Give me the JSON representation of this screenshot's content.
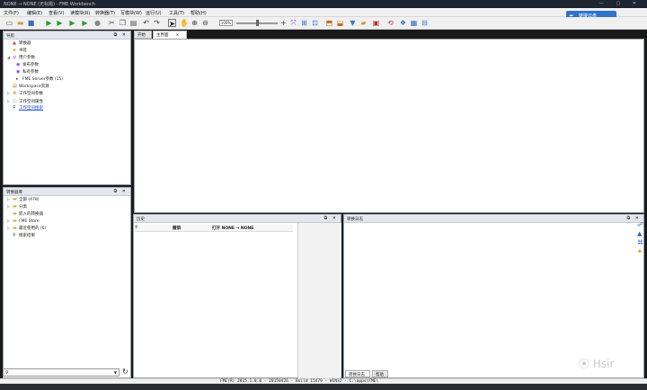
{
  "window": {
    "title": "NONE → NONE (无标题) - FME Workbench",
    "controls": "— ▢ ✕"
  },
  "menu": [
    "文件(F)",
    "编辑(E)",
    "查看(V)",
    "读模块(R)",
    "转换器(T)",
    "写模块(W)",
    "运行(U)",
    "工具(T)",
    "帮助(H)"
  ],
  "cloud_button": {
    "label": "链接云盘",
    "icon": "cloud-icon"
  },
  "toolbar": {
    "zoom_value": "100%"
  },
  "nav_panel": {
    "title": "导航",
    "items": [
      {
        "label": "转换器",
        "icon": "transformer-icon",
        "indent": 0
      },
      {
        "label": "书签",
        "icon": "bookmark-icon",
        "indent": 0
      },
      {
        "label": "用户参数",
        "icon": "parameters-icon",
        "indent": 0,
        "expanded": true
      },
      {
        "label": "发布参数",
        "icon": "publish-icon",
        "indent": 1
      },
      {
        "label": "私有参数",
        "icon": "private-icon",
        "indent": 1
      },
      {
        "label": "FME Server参数 (15)",
        "icon": "server-icon",
        "indent": 1
      },
      {
        "label": "Workspace资源",
        "icon": "resource-icon",
        "indent": 0
      },
      {
        "label": "工作空间参数",
        "icon": "settings-icon",
        "indent": 0
      },
      {
        "label": "工作空间属性",
        "icon": "info-icon",
        "indent": 0
      },
      {
        "label": "工作空间搜索",
        "icon": "search-icon",
        "indent": 0
      }
    ]
  },
  "gallery_panel": {
    "title": "转换器库",
    "items": [
      {
        "label": "全部 (478)",
        "icon": "folder-icon"
      },
      {
        "label": "分类",
        "icon": "folder-icon"
      },
      {
        "label": "嵌入的转换器",
        "icon": "folder-icon"
      },
      {
        "label": "FME Store",
        "icon": "folder-icon"
      },
      {
        "label": "最近使用的 (6)",
        "icon": "folder-icon"
      },
      {
        "label": "搜索结果",
        "icon": "search-icon"
      }
    ]
  },
  "canvas_tabs": [
    {
      "label": "开始",
      "active": false
    },
    {
      "label": "主界面",
      "active": true
    }
  ],
  "history_panel": {
    "title": "历史",
    "columns": [
      "撤销",
      "打开 NONE → NONE"
    ]
  },
  "log_panel": {
    "title": "转换日志",
    "tabs": [
      {
        "label": "转换日志",
        "active": true
      },
      {
        "label": "帮助",
        "active": false
      }
    ]
  },
  "status": "FME(R) 2015.1.0.0 - 20150426 - Build 15479 - WIN32 - C:\\apps\\FME\\",
  "watermark": "Hsir"
}
